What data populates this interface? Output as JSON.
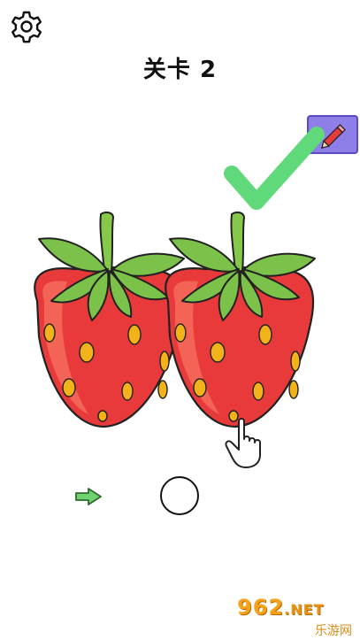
{
  "header": {
    "level_title": "关卡 2"
  },
  "icons": {
    "settings": "gear-icon",
    "edit": "pencil-icon",
    "result": "checkmark-icon",
    "hint_pointer": "hand-pointer-icon",
    "next": "arrow-right-icon"
  },
  "colors": {
    "check_green": "#5fd97a",
    "button_purple": "#8e7ee8",
    "strawberry_red": "#e83a3a",
    "leaf_green": "#7cc24a",
    "seed_yellow": "#f2b31a",
    "arrow_green": "#6fd46f"
  },
  "watermark": {
    "main": "962",
    "suffix": ".NET",
    "sub": "乐游网"
  }
}
